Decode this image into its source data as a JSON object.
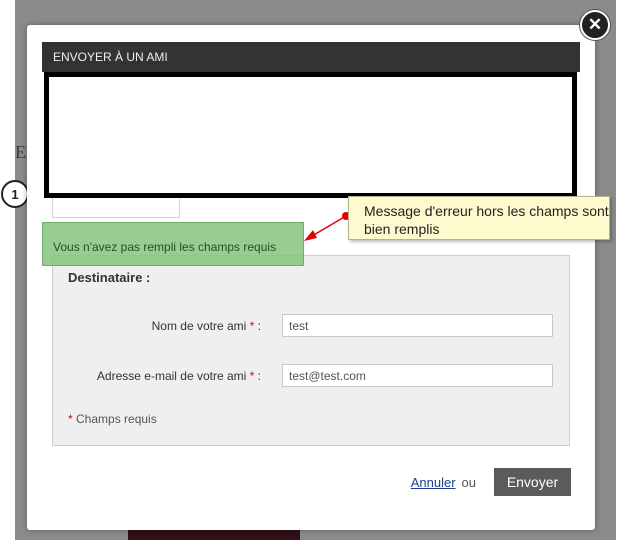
{
  "background": {
    "fragment_text": "EL"
  },
  "step_badge": "1",
  "modal": {
    "title": "ENVOYER À UN AMI",
    "close_icon": "close-icon"
  },
  "error_message": "Vous n'avez pas rempli les champs requis",
  "form": {
    "section_heading": "Destinataire :",
    "fields": [
      {
        "label": "Nom de votre ami",
        "required_mark": "*",
        "suffix": " :",
        "value": "test"
      },
      {
        "label": "Adresse e-mail de votre ami",
        "required_mark": "*",
        "suffix": " :",
        "value": "test@test.com"
      }
    ],
    "required_note_mark": "*",
    "required_note": "Champs requis"
  },
  "actions": {
    "cancel_label": "Annuler",
    "or_text": "ou",
    "send_label": "Envoyer"
  },
  "annotation": {
    "text": "Message d'erreur hors les champs sont bien remplis"
  },
  "colors": {
    "title_bar": "#333333",
    "error_bg": "#85c47e",
    "callout_bg": "#fdfbcd",
    "callout_arrow": "#e00000",
    "send_button": "#5b5b5b"
  }
}
